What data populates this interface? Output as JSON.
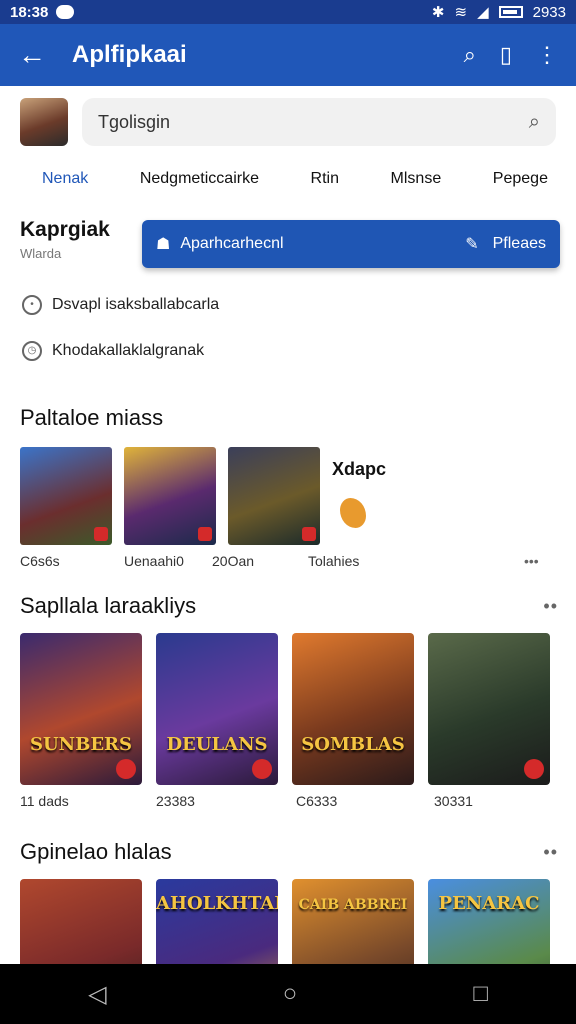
{
  "status_bar": {
    "time": "18:38",
    "battery_text": "2933"
  },
  "app_bar": {
    "title": "Aplfipkaai"
  },
  "search": {
    "placeholder": "Tgolisgin"
  },
  "tabs": [
    "Nenak",
    "Nedgmeticcairke",
    "Rtin",
    "Mlsnse",
    "Pepege"
  ],
  "profile": {
    "name": "Kaprgiak",
    "subtitle": "Wlarda"
  },
  "blue_bar": {
    "label": "Aparhcarhecnl",
    "action_label": "Pfleaes"
  },
  "links": [
    "Dsvapl isaksballabcarla",
    "Khodakallaklalgranak"
  ],
  "sections": {
    "s1": {
      "title": "Paltaloe miass",
      "captions": [
        "C6s6s",
        "Uenaahi0",
        "20Oan",
        "Tolahies"
      ],
      "promo_label": "Xdapc"
    },
    "s2": {
      "title": "Sapllala laraakliys",
      "cards": [
        "SUNBERS",
        "DEULANS",
        "SOMBLAS",
        ""
      ],
      "captions": [
        "11 dads",
        "23383",
        "C6333",
        "30331"
      ]
    },
    "s3": {
      "title": "Gpinelao hlalas",
      "cards": [
        "",
        "AHOLKHTAN",
        "CAIB ABBREI",
        "PENARAC"
      ]
    }
  },
  "colors": {
    "accent": "#2057b8",
    "status_bar": "#1a3c8f",
    "badge": "#d42a2a"
  }
}
